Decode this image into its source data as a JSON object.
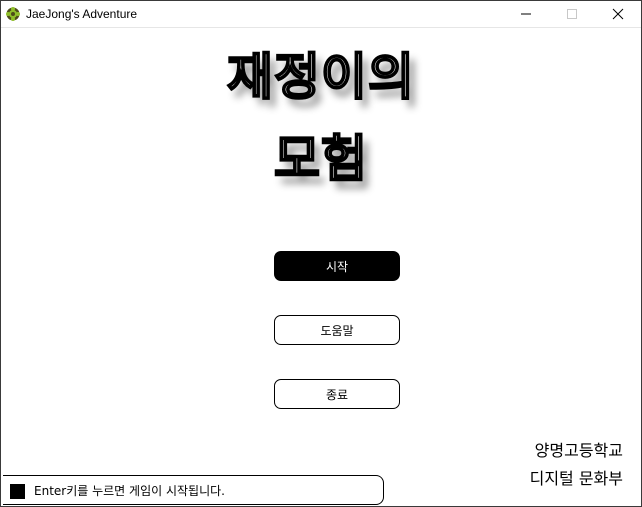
{
  "window": {
    "title": "JaeJong's Adventure",
    "controls": {
      "minimize": "minimize",
      "maximize": "maximize",
      "close": "close"
    }
  },
  "game": {
    "title_line1": "재정이의",
    "title_line2": "모험"
  },
  "menu": {
    "start": "시작",
    "help": "도움말",
    "quit": "종료"
  },
  "credits": {
    "school": "양명고등학교",
    "club": "디지털 문화부"
  },
  "status": {
    "message": "Enter키를 누르면 게임이 시작됩니다."
  },
  "colors": {
    "accent": "#000000",
    "background": "#ffffff",
    "app_icon": "#6b8e23"
  }
}
